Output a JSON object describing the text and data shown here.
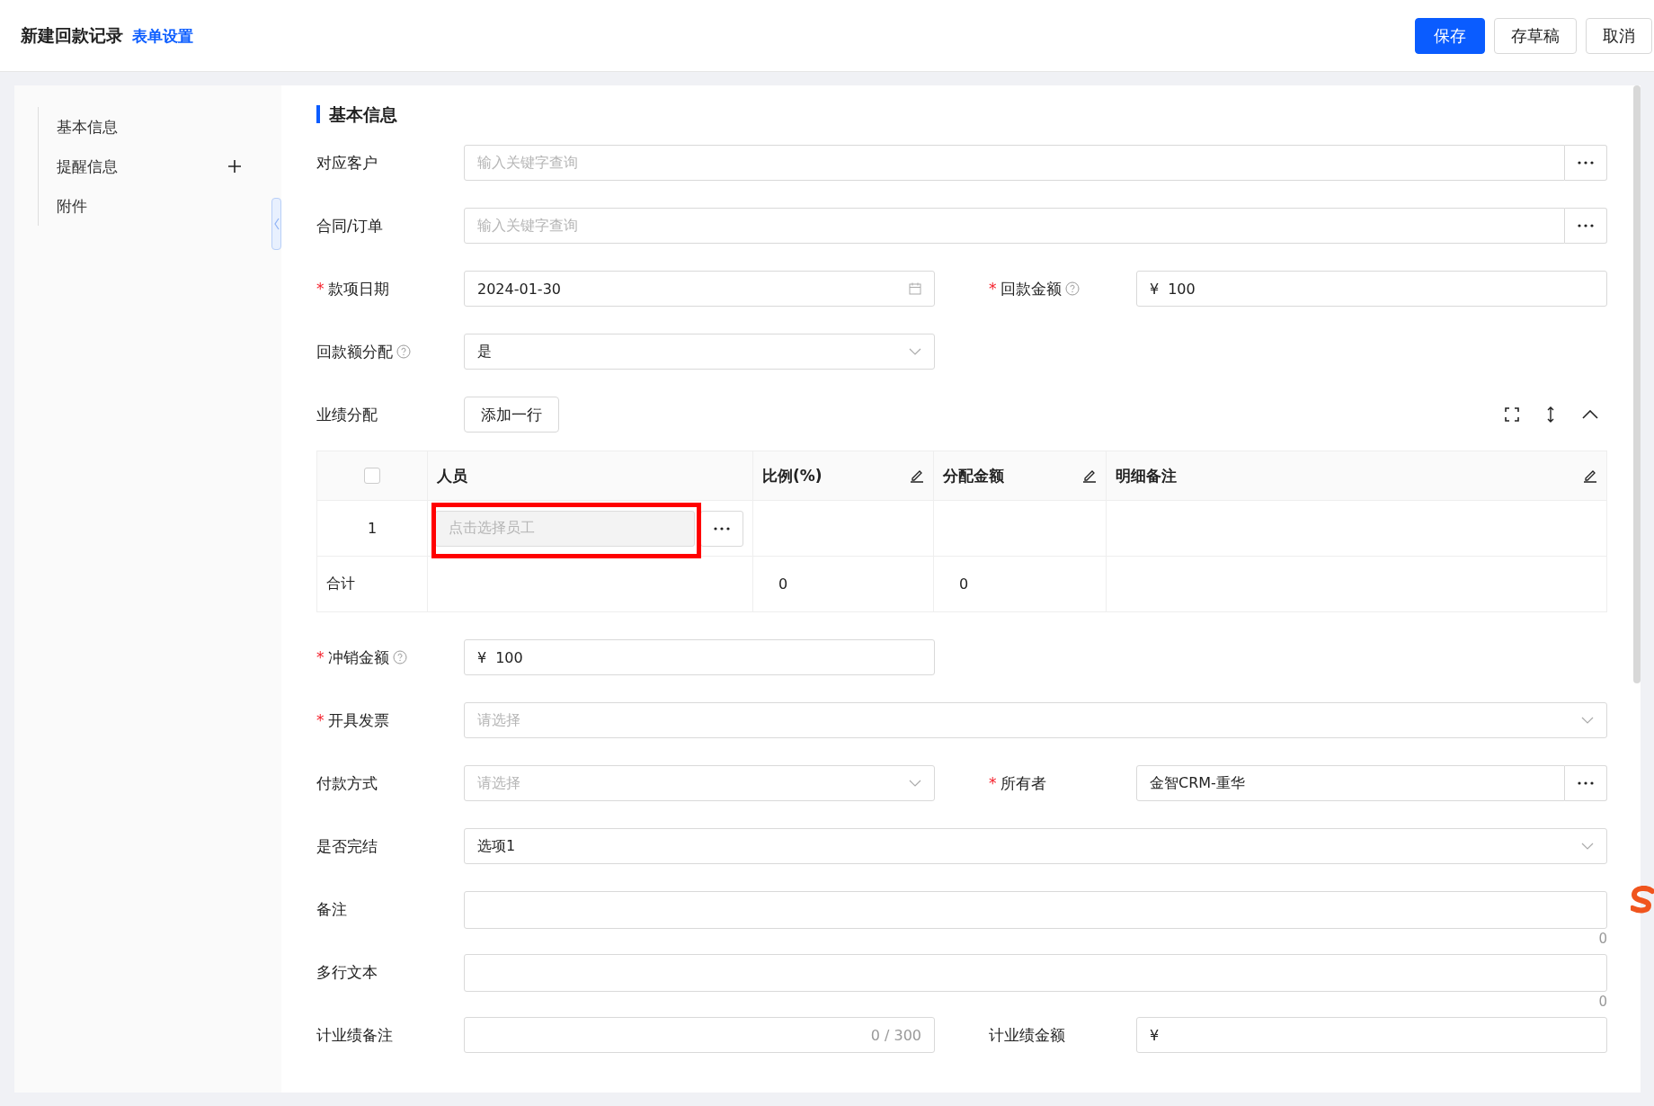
{
  "header": {
    "title": "新建回款记录",
    "settings_link": "表单设置",
    "buttons": [
      {
        "label": "保存",
        "kind": "primary"
      },
      {
        "label": "存草稿",
        "kind": "default"
      },
      {
        "label": "取消",
        "kind": "default"
      }
    ]
  },
  "sidebar": {
    "items": [
      {
        "label": "基本信息",
        "addable": false
      },
      {
        "label": "提醒信息",
        "addable": true
      },
      {
        "label": "附件",
        "addable": false
      }
    ]
  },
  "section": {
    "title": "基本信息"
  },
  "rows": [
    {
      "kind": "fields",
      "fields": [
        {
          "label": "对应客户",
          "help": false,
          "kind": "lookup",
          "wide": true,
          "placeholder": "输入关键字查询"
        }
      ]
    },
    {
      "kind": "fields",
      "fields": [
        {
          "label": "合同/订单",
          "help": false,
          "kind": "lookup",
          "wide": true,
          "placeholder": "输入关键字查询"
        }
      ]
    },
    {
      "kind": "fields",
      "fields": [
        {
          "label": "款项日期",
          "required_mark": "*",
          "help": false,
          "kind": "date",
          "wide": false,
          "value": "2024-01-30"
        },
        {
          "label": "回款金额",
          "required_mark": "*",
          "help": true,
          "kind": "money",
          "wide": false,
          "currency": "¥",
          "value": "100"
        }
      ]
    },
    {
      "kind": "fields",
      "fields": [
        {
          "label": "回款额分配",
          "help": true,
          "kind": "select",
          "wide": false,
          "value": "是"
        }
      ]
    },
    {
      "kind": "table",
      "label": "业绩分配",
      "add_button": "添加一行",
      "select_all_checked": false,
      "columns": [
        {
          "label": "人员",
          "editable": false
        },
        {
          "label": "比例(%)",
          "editable": true
        },
        {
          "label": "分配金额",
          "editable": true
        },
        {
          "label": "明细备注",
          "editable": true
        }
      ],
      "rows": [
        {
          "index": "1",
          "placeholder": "点击选择员工",
          "highlighted": true
        }
      ],
      "total": {
        "label": "合计",
        "values": [
          "0",
          "0"
        ]
      }
    },
    {
      "kind": "fields",
      "fields": [
        {
          "label": "冲销金额",
          "required_mark": "*",
          "help": true,
          "kind": "money",
          "wide": false,
          "currency": "¥",
          "value": "100"
        }
      ]
    },
    {
      "kind": "fields",
      "fields": [
        {
          "label": "开具发票",
          "required_mark": "*",
          "help": false,
          "kind": "select",
          "wide": true,
          "placeholder": "请选择"
        }
      ]
    },
    {
      "kind": "fields",
      "fields": [
        {
          "label": "付款方式",
          "help": false,
          "kind": "select",
          "wide": false,
          "placeholder": "请选择"
        },
        {
          "label": "所有者",
          "required_mark": "*",
          "help": false,
          "kind": "lookup",
          "wide": false,
          "value": "金智CRM-重华"
        }
      ]
    },
    {
      "kind": "fields",
      "fields": [
        {
          "label": "是否完结",
          "help": false,
          "kind": "select",
          "wide": true,
          "value": "选项1"
        }
      ]
    },
    {
      "kind": "fields",
      "fields": [
        {
          "label": "备注",
          "help": false,
          "kind": "textarea",
          "wide": true,
          "counter": "0"
        }
      ]
    },
    {
      "kind": "fields",
      "fields": [
        {
          "label": "多行文本",
          "help": false,
          "kind": "textarea",
          "wide": true,
          "counter": "0"
        }
      ]
    },
    {
      "kind": "fields",
      "fields": [
        {
          "label": "计业绩备注",
          "help": false,
          "kind": "text",
          "wide": false,
          "counter": "0 / 300"
        },
        {
          "label": "计业绩金额",
          "help": false,
          "kind": "money",
          "wide": false,
          "currency": "¥"
        }
      ]
    }
  ]
}
